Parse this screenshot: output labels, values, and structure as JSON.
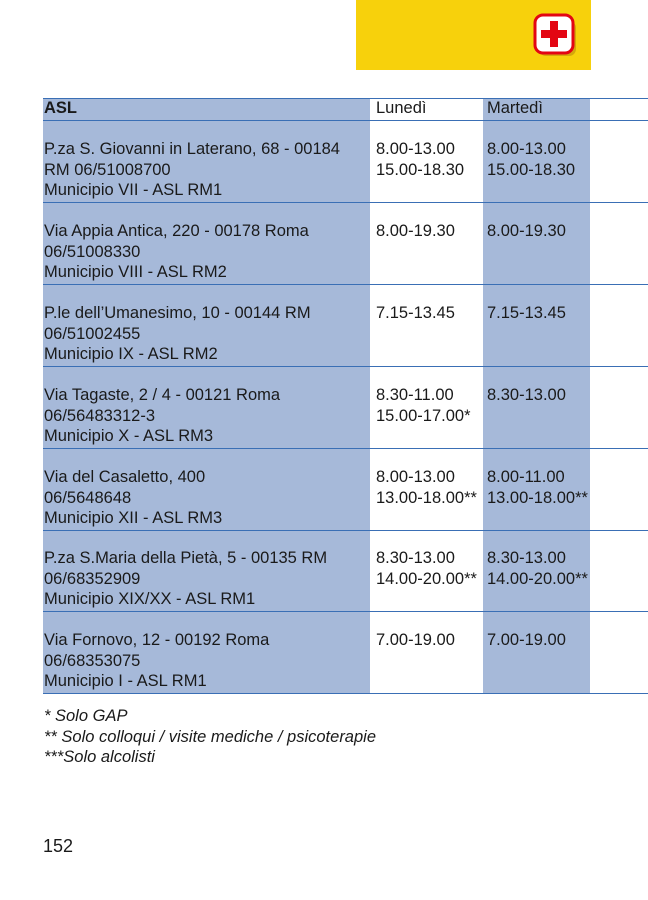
{
  "header": {
    "icon": "first-aid-cross-icon",
    "accent_color": "#f7d10c",
    "cross_color": "#e30613"
  },
  "table": {
    "columns": [
      "ASL",
      "Lunedì",
      "Martedì"
    ],
    "rows": [
      {
        "asl": [
          "P.za S. Giovanni in Laterano, 68 - 00184",
          "RM  06/51008700",
          "Municipio VII - ASL RM1"
        ],
        "lunedi": [
          "8.00-13.00",
          "15.00-18.30"
        ],
        "martedi": [
          "8.00-13.00",
          "15.00-18.30"
        ]
      },
      {
        "asl": [
          "Via Appia Antica, 220 - 00178 Roma",
          "06/51008330",
          "Municipio VIII - ASL RM2"
        ],
        "lunedi": [
          "8.00-19.30"
        ],
        "martedi": [
          "8.00-19.30"
        ]
      },
      {
        "asl": [
          "P.le dell’Umanesimo, 10 - 00144 RM",
          "06/51002455",
          "Municipio IX - ASL RM2"
        ],
        "lunedi": [
          "7.15-13.45"
        ],
        "martedi": [
          "7.15-13.45"
        ]
      },
      {
        "asl": [
          "Via Tagaste, 2 / 4 - 00121 Roma",
          "06/56483312-3",
          "Municipio X - ASL RM3"
        ],
        "lunedi": [
          "8.30-11.00",
          "15.00-17.00*"
        ],
        "martedi": [
          "8.30-13.00"
        ]
      },
      {
        "asl": [
          "Via del Casaletto, 400",
          "06/5648648",
          "Municipio XII - ASL RM3"
        ],
        "lunedi": [
          "8.00-13.00",
          "13.00-18.00**"
        ],
        "martedi": [
          "8.00-11.00",
          "13.00-18.00**"
        ]
      },
      {
        "asl": [
          "P.za S.Maria della Pietà, 5 - 00135 RM",
          "06/68352909",
          "Municipio XIX/XX - ASL RM1"
        ],
        "lunedi": [
          "8.30-13.00",
          "14.00-20.00**"
        ],
        "martedi": [
          "8.30-13.00",
          "14.00-20.00**"
        ]
      },
      {
        "asl": [
          "Via Fornovo, 12 - 00192 Roma",
          "06/68353075",
          "Municipio I - ASL RM1"
        ],
        "lunedi": [
          "7.00-19.00"
        ],
        "martedi": [
          "7.00-19.00"
        ]
      }
    ]
  },
  "notes": [
    "* Solo GAP",
    "** Solo colloqui / visite mediche / psicoterapie",
    "***Solo alcolisti"
  ],
  "page_number": "152"
}
